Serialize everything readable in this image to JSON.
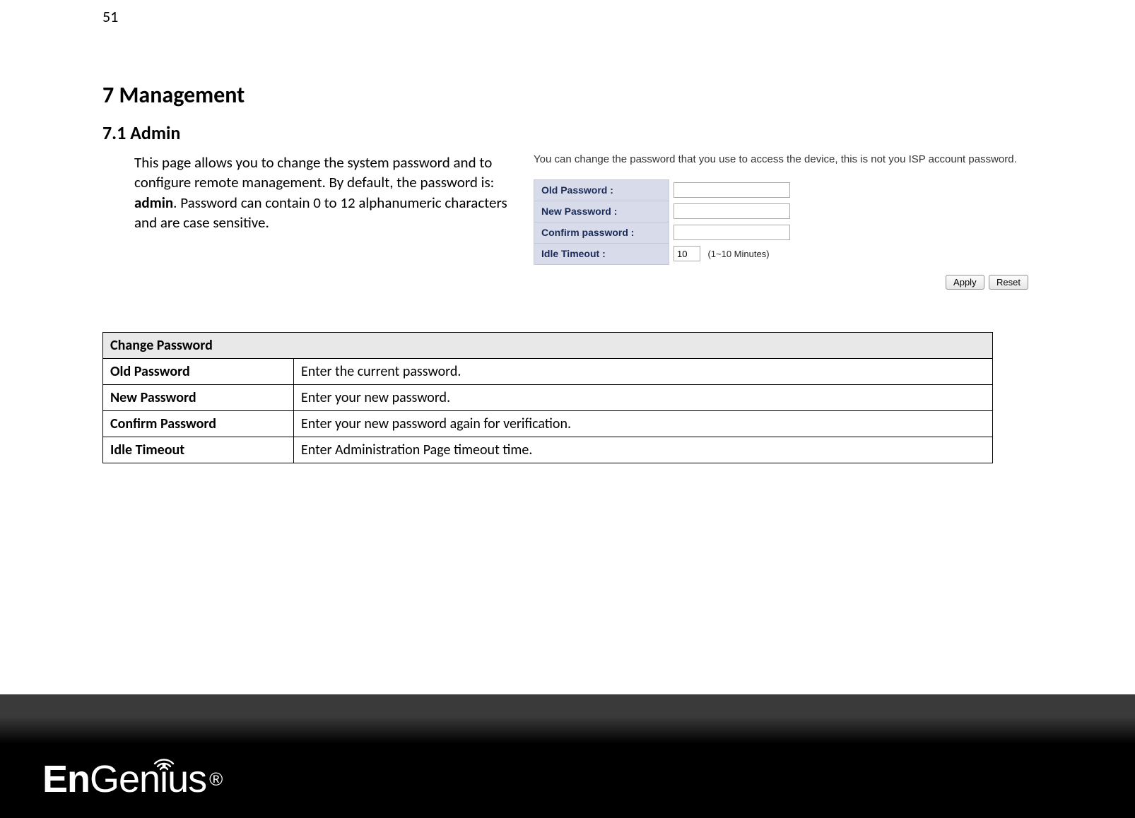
{
  "page_number": "51",
  "heading1": "7   Management",
  "heading2": "7.1    Admin",
  "description_parts": {
    "p1": "This page allows you to change the system password and to configure remote management. By default, the password is: ",
    "bold": "admin",
    "p2": ". Password can contain 0 to 12 alphanumeric characters and are case sensitive."
  },
  "screenshot": {
    "intro": "You can change the password that you use to access the device, this is not you ISP account password.",
    "rows": [
      {
        "label": "Old Password :",
        "type": "password",
        "value": ""
      },
      {
        "label": "New Password :",
        "type": "password",
        "value": ""
      },
      {
        "label": "Confirm password :",
        "type": "password",
        "value": ""
      }
    ],
    "idle_label": "Idle Timeout :",
    "idle_value": "10",
    "idle_hint": "(1~10 Minutes)",
    "apply": "Apply",
    "reset": "Reset"
  },
  "table": {
    "header": "Change Password",
    "rows": [
      {
        "key": "Old Password",
        "val": "Enter the current password."
      },
      {
        "key": "New Password",
        "val": "Enter your new password."
      },
      {
        "key": "Confirm Password",
        "val": "Enter your new password again for verification."
      },
      {
        "key": "Idle Timeout",
        "val": "Enter Administration Page timeout time."
      }
    ]
  },
  "logo": {
    "part1": "En",
    "part2": "Gen",
    "part3": "i",
    "part4": "us",
    "reg": "®"
  }
}
